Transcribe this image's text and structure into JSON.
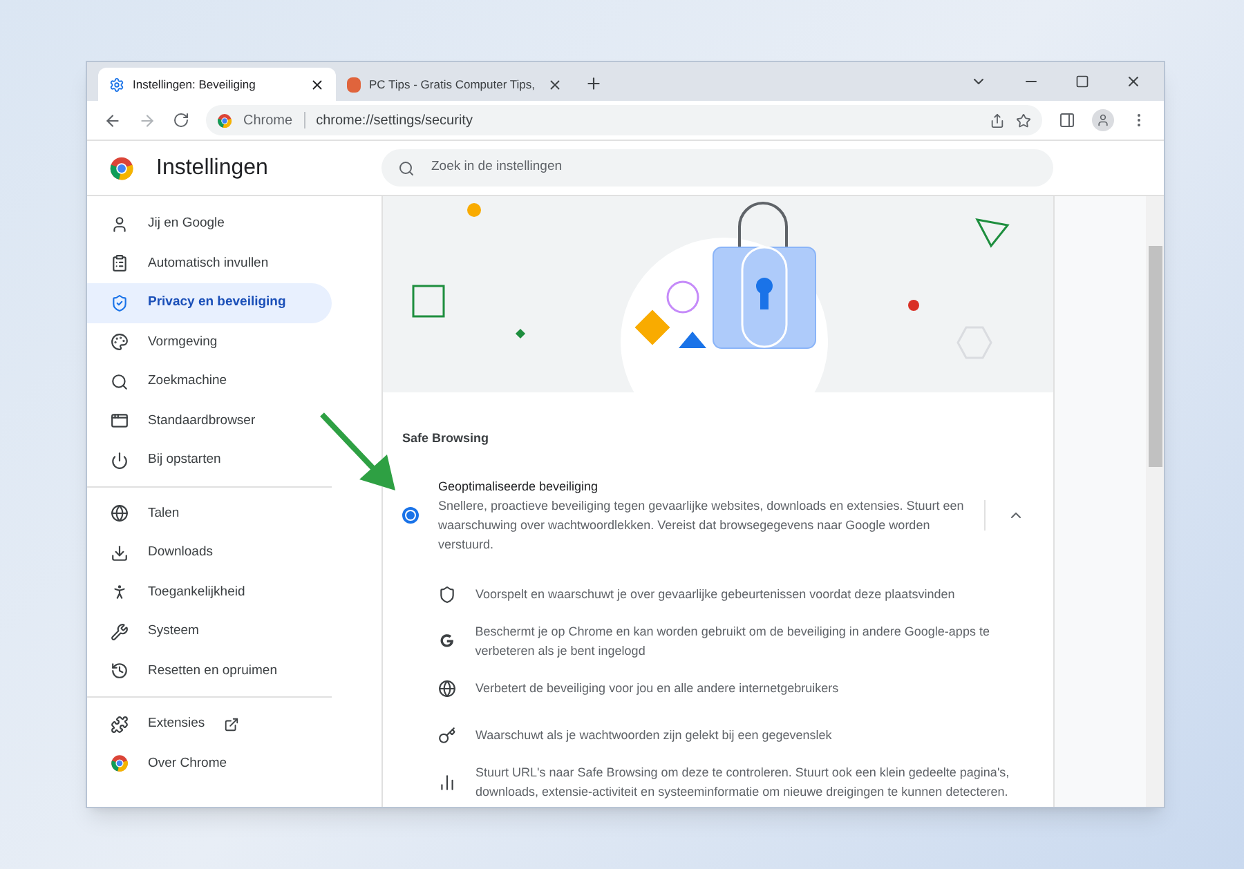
{
  "tabs": [
    {
      "title": "Instellingen: Beveiliging",
      "selected": true
    },
    {
      "title": "PC Tips - Gratis Computer Tips,",
      "selected": false
    }
  ],
  "address_bar": {
    "site": "Chrome",
    "url": "chrome://settings/security"
  },
  "header": {
    "title": "Instellingen",
    "search": {
      "placeholder": "Zoek in de instellingen"
    }
  },
  "sidebar": {
    "groups": [
      {
        "items": [
          {
            "label": "Jij en Google",
            "selected": false
          },
          {
            "label": "Automatisch invullen",
            "selected": false
          },
          {
            "label": "Privacy en beveiliging",
            "selected": true
          },
          {
            "label": "Vormgeving",
            "selected": false
          },
          {
            "label": "Zoekmachine",
            "selected": false
          },
          {
            "label": "Standaardbrowser",
            "selected": false
          },
          {
            "label": "Bij opstarten",
            "selected": false
          }
        ]
      },
      {
        "items": [
          {
            "label": "Talen",
            "selected": false
          },
          {
            "label": "Downloads",
            "selected": false
          },
          {
            "label": "Toegankelijkheid",
            "selected": false
          },
          {
            "label": "Systeem",
            "selected": false
          },
          {
            "label": "Resetten en opruimen",
            "selected": false
          }
        ]
      },
      {
        "items": [
          {
            "label": "Extensies",
            "selected": false,
            "external": true
          },
          {
            "label": "Over Chrome",
            "selected": false
          }
        ]
      }
    ]
  },
  "section": {
    "heading": "Safe Browsing",
    "option": {
      "title": "Geoptimaliseerde beveiliging",
      "description": "Snellere, proactieve beveiliging tegen gevaarlijke websites, downloads en extensies. Stuurt een waarschuwing over wachtwoordlekken. Vereist dat browsegegevens naar Google worden verstuurd.",
      "selected": true,
      "expanded": true
    },
    "features": [
      {
        "text": "Voorspelt en waarschuwt je over gevaarlijke gebeurtenissen voordat deze plaatsvinden"
      },
      {
        "text": "Beschermt je op Chrome en kan worden gebruikt om de beveiliging in andere Google-apps te verbeteren als je bent ingelogd"
      },
      {
        "text": "Verbetert de beveiliging voor jou en alle andere internetgebruikers"
      },
      {
        "text": "Waarschuwt als je wachtwoorden zijn gelekt bij een gegevenslek"
      },
      {
        "text": "Stuurt URL's naar Safe Browsing om deze te controleren. Stuurt ook een klein gedeelte pagina's, downloads, extensie-activiteit en systeeminformatie om nieuwe dreigingen te kunnen detecteren."
      }
    ]
  }
}
